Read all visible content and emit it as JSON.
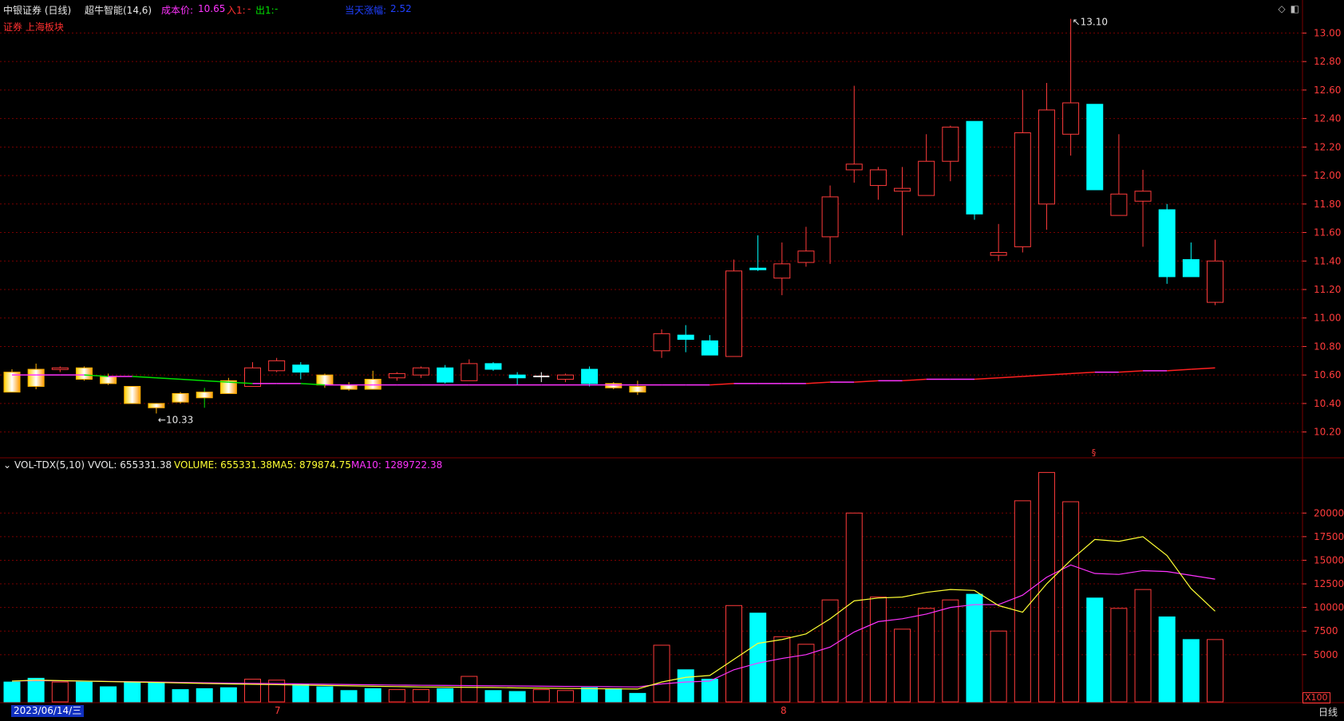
{
  "header": {
    "stock": "中银证券 (日线)",
    "indicator": "超牛智能(14,6)",
    "cost_label": "成本价:",
    "cost_value": "10.65",
    "in_label": "入1:",
    "in_value": "-",
    "out_label": "出1:",
    "out_value": "-",
    "change_label": "当天涨幅:",
    "change_value": "2.52",
    "sector": "证券 上海板块"
  },
  "vol_header": {
    "name": "VOL-TDX(5,10)",
    "vvol": "VVOL: 655331.38",
    "volume": "VOLUME: 655331.38",
    "ma5": "MA5: 879874.75",
    "ma10": "MA10: 1289722.38"
  },
  "footer": {
    "date": "2023/06/14/三",
    "month_7": "7",
    "month_8": "8",
    "period": "日线",
    "multiplier": "X100"
  },
  "colors": {
    "up": "#ff3b3b",
    "down": "#00ffff",
    "grid": "#7a0000",
    "ma_main": "#ff33ff",
    "ma5": "#ffff33",
    "ma10": "#ff33ff"
  },
  "chart_data": [
    {
      "type": "candlestick",
      "price_axis": [
        10.2,
        10.4,
        10.6,
        10.8,
        11.0,
        11.2,
        11.4,
        11.6,
        11.8,
        12.0,
        12.2,
        12.4,
        12.6,
        12.8,
        13.0
      ],
      "ylim": [
        10.03,
        13.12
      ],
      "annotations": {
        "high": "13.10",
        "low": "10.33"
      },
      "candles": [
        {
          "o": 10.48,
          "h": 10.64,
          "l": 10.48,
          "c": 10.62,
          "s": "gold"
        },
        {
          "o": 10.52,
          "h": 10.68,
          "l": 10.5,
          "c": 10.64,
          "s": "gold"
        },
        {
          "o": 10.64,
          "h": 10.66,
          "l": 10.62,
          "c": 10.65,
          "s": "up"
        },
        {
          "o": 10.65,
          "h": 10.66,
          "l": 10.56,
          "c": 10.57,
          "s": "gold"
        },
        {
          "o": 10.59,
          "h": 10.61,
          "l": 10.53,
          "c": 10.54,
          "s": "gold"
        },
        {
          "o": 10.52,
          "h": 10.52,
          "l": 10.4,
          "c": 10.4,
          "s": "gold"
        },
        {
          "o": 10.4,
          "h": 10.4,
          "l": 10.33,
          "c": 10.37,
          "s": "gold"
        },
        {
          "o": 10.41,
          "h": 10.48,
          "l": 10.4,
          "c": 10.47,
          "s": "gold"
        },
        {
          "o": 10.48,
          "h": 10.51,
          "l": 10.37,
          "c": 10.44,
          "s": "gold"
        },
        {
          "o": 10.47,
          "h": 10.58,
          "l": 10.47,
          "c": 10.56,
          "s": "gold"
        },
        {
          "o": 10.52,
          "h": 10.69,
          "l": 10.52,
          "c": 10.65,
          "s": "up"
        },
        {
          "o": 10.63,
          "h": 10.72,
          "l": 10.62,
          "c": 10.7,
          "s": "up"
        },
        {
          "o": 10.67,
          "h": 10.69,
          "l": 10.57,
          "c": 10.62,
          "s": "down"
        },
        {
          "o": 10.6,
          "h": 10.61,
          "l": 10.51,
          "c": 10.53,
          "s": "gold"
        },
        {
          "o": 10.53,
          "h": 10.55,
          "l": 10.49,
          "c": 10.5,
          "s": "gold"
        },
        {
          "o": 10.5,
          "h": 10.63,
          "l": 10.5,
          "c": 10.57,
          "s": "gold"
        },
        {
          "o": 10.58,
          "h": 10.62,
          "l": 10.56,
          "c": 10.61,
          "s": "up"
        },
        {
          "o": 10.6,
          "h": 10.66,
          "l": 10.58,
          "c": 10.65,
          "s": "up"
        },
        {
          "o": 10.65,
          "h": 10.67,
          "l": 10.54,
          "c": 10.55,
          "s": "down"
        },
        {
          "o": 10.56,
          "h": 10.71,
          "l": 10.56,
          "c": 10.68,
          "s": "up"
        },
        {
          "o": 10.68,
          "h": 10.69,
          "l": 10.63,
          "c": 10.64,
          "s": "down"
        },
        {
          "o": 10.6,
          "h": 10.62,
          "l": 10.53,
          "c": 10.58,
          "s": "down"
        },
        {
          "o": 10.59,
          "h": 10.62,
          "l": 10.55,
          "c": 10.59,
          "s": "cross"
        },
        {
          "o": 10.57,
          "h": 10.61,
          "l": 10.55,
          "c": 10.6,
          "s": "up"
        },
        {
          "o": 10.64,
          "h": 10.66,
          "l": 10.52,
          "c": 10.54,
          "s": "down"
        },
        {
          "o": 10.54,
          "h": 10.55,
          "l": 10.5,
          "c": 10.51,
          "s": "gold"
        },
        {
          "o": 10.52,
          "h": 10.56,
          "l": 10.46,
          "c": 10.48,
          "s": "gold"
        },
        {
          "o": 10.77,
          "h": 10.92,
          "l": 10.72,
          "c": 10.89,
          "s": "up"
        },
        {
          "o": 10.88,
          "h": 10.95,
          "l": 10.76,
          "c": 10.85,
          "s": "down"
        },
        {
          "o": 10.84,
          "h": 10.88,
          "l": 10.74,
          "c": 10.74,
          "s": "down"
        },
        {
          "o": 10.73,
          "h": 11.41,
          "l": 10.73,
          "c": 11.33,
          "s": "up"
        },
        {
          "o": 11.35,
          "h": 11.58,
          "l": 11.33,
          "c": 11.34,
          "s": "down"
        },
        {
          "o": 11.28,
          "h": 11.53,
          "l": 11.16,
          "c": 11.38,
          "s": "up"
        },
        {
          "o": 11.39,
          "h": 11.64,
          "l": 11.36,
          "c": 11.47,
          "s": "up"
        },
        {
          "o": 11.57,
          "h": 11.93,
          "l": 11.38,
          "c": 11.85,
          "s": "up"
        },
        {
          "o": 12.04,
          "h": 12.63,
          "l": 11.95,
          "c": 12.08,
          "s": "up"
        },
        {
          "o": 11.93,
          "h": 12.06,
          "l": 11.83,
          "c": 12.04,
          "s": "up"
        },
        {
          "o": 11.89,
          "h": 12.06,
          "l": 11.58,
          "c": 11.91,
          "s": "up"
        },
        {
          "o": 11.86,
          "h": 12.29,
          "l": 11.86,
          "c": 12.1,
          "s": "up"
        },
        {
          "o": 12.1,
          "h": 12.35,
          "l": 11.96,
          "c": 12.34,
          "s": "up"
        },
        {
          "o": 12.38,
          "h": 12.38,
          "l": 11.69,
          "c": 11.73,
          "s": "down"
        },
        {
          "o": 11.44,
          "h": 11.66,
          "l": 11.4,
          "c": 11.46,
          "s": "up"
        },
        {
          "o": 11.5,
          "h": 12.6,
          "l": 11.46,
          "c": 12.3,
          "s": "up"
        },
        {
          "o": 11.8,
          "h": 12.65,
          "l": 11.62,
          "c": 12.46,
          "s": "up"
        },
        {
          "o": 12.29,
          "h": 13.1,
          "l": 12.14,
          "c": 12.51,
          "s": "up"
        },
        {
          "o": 12.5,
          "h": 12.5,
          "l": 11.9,
          "c": 11.9,
          "s": "down"
        },
        {
          "o": 11.72,
          "h": 12.29,
          "l": 11.72,
          "c": 11.87,
          "s": "up"
        },
        {
          "o": 11.82,
          "h": 12.04,
          "l": 11.5,
          "c": 11.89,
          "s": "up"
        },
        {
          "o": 11.76,
          "h": 11.8,
          "l": 11.24,
          "c": 11.29,
          "s": "down"
        },
        {
          "o": 11.41,
          "h": 11.53,
          "l": 11.29,
          "c": 11.29,
          "s": "down"
        },
        {
          "o": 11.11,
          "h": 11.55,
          "l": 11.09,
          "c": 11.4,
          "s": "up"
        }
      ],
      "ma_line": [
        10.6,
        10.6,
        10.6,
        10.6,
        10.59,
        10.59,
        10.58,
        10.57,
        10.56,
        10.55,
        10.54,
        10.54,
        10.54,
        10.53,
        10.53,
        10.53,
        10.53,
        10.53,
        10.53,
        10.53,
        10.53,
        10.53,
        10.53,
        10.53,
        10.53,
        10.53,
        10.53,
        10.53,
        10.53,
        10.53,
        10.54,
        10.54,
        10.54,
        10.54,
        10.55,
        10.55,
        10.56,
        10.56,
        10.57,
        10.57,
        10.57,
        10.58,
        10.59,
        10.6,
        10.61,
        10.62,
        10.62,
        10.63,
        10.63,
        10.64,
        10.65
      ]
    },
    {
      "type": "bar",
      "y_axis": [
        5000,
        7500,
        10000,
        12500,
        15000,
        17500,
        20000
      ],
      "ylim": [
        0,
        24500
      ],
      "volume": [
        2100,
        2500,
        2100,
        2100,
        1600,
        2100,
        2000,
        1300,
        1400,
        1500,
        2400,
        2300,
        1900,
        1600,
        1200,
        1400,
        1300,
        1300,
        1400,
        2700,
        1200,
        1100,
        1300,
        1200,
        1500,
        1400,
        900,
        6000,
        3400,
        2400,
        10200,
        9400,
        6900,
        6100,
        10800,
        20000,
        11100,
        7700,
        9900,
        10800,
        11400,
        7500,
        21300,
        24300,
        21200,
        11000,
        9900,
        11900,
        9000,
        6600,
        6600
      ],
      "ma5": [
        2200,
        2300,
        2250,
        2200,
        2150,
        2100,
        2060,
        2000,
        1950,
        1900,
        1860,
        1820,
        1780,
        1740,
        1700,
        1660,
        1620,
        1580,
        1560,
        1540,
        1520,
        1480,
        1460,
        1420,
        1400,
        1380,
        1360,
        2100,
        2600,
        2800,
        4500,
        6200,
        6600,
        7200,
        8800,
        10700,
        11000,
        11100,
        11600,
        11900,
        11800,
        10200,
        9500,
        12500,
        15000,
        17200,
        17000,
        17500,
        15500,
        12000,
        9600,
        8800
      ],
      "ma10": [
        2200,
        2250,
        2230,
        2200,
        2170,
        2140,
        2100,
        2060,
        2020,
        1990,
        1960,
        1930,
        1900,
        1870,
        1840,
        1810,
        1780,
        1760,
        1740,
        1720,
        1700,
        1680,
        1660,
        1640,
        1620,
        1600,
        1580,
        1900,
        2100,
        2200,
        3400,
        4100,
        4600,
        5000,
        5800,
        7400,
        8500,
        8800,
        9300,
        10000,
        10300,
        10300,
        11300,
        13200,
        14500,
        13600,
        13500,
        13900,
        13800,
        13400,
        13000
      ]
    }
  ]
}
